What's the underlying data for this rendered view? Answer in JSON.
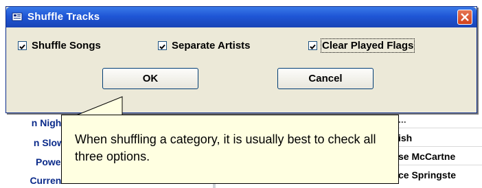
{
  "dialog": {
    "title": "Shuffle Tracks",
    "checkboxes": [
      {
        "label": "Shuffle Songs",
        "checked": true
      },
      {
        "label": "Separate Artists",
        "checked": true
      },
      {
        "label": "Clear Played Flags",
        "checked": true
      }
    ],
    "ok_label": "OK",
    "cancel_label": "Cancel"
  },
  "tooltip": {
    "text": "When shuffling a category, it is usually best to check all three options."
  },
  "background": {
    "left_items": [
      "n Night",
      "n Slow",
      "Power",
      "Current"
    ],
    "right_items": [
      "...",
      "ish",
      "se McCartne",
      "ce Springste"
    ]
  },
  "colors": {
    "titlebar": "#1f56d6",
    "dialog_bg": "#ece9d8",
    "tooltip_bg": "#ffffe1",
    "list_text": "#0a2a8a"
  }
}
